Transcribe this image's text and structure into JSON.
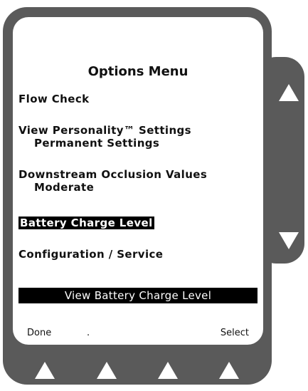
{
  "screen": {
    "title": "Options Menu",
    "menu_items": [
      {
        "label": "Flow Check",
        "sub": ""
      },
      {
        "label": "View Personality™ Settings",
        "sub": "Permanent Settings"
      },
      {
        "label": "Downstream Occlusion Values",
        "sub": "Moderate"
      },
      {
        "label": "Battery Charge Level",
        "sub": "",
        "selected": true
      },
      {
        "label": "Configuration / Service",
        "sub": ""
      }
    ],
    "status_text": "View Battery Charge Level",
    "softkeys": {
      "left": "Done",
      "middle": ".",
      "right": "Select"
    }
  },
  "hardware_buttons": {
    "side": [
      "up-arrow-icon",
      "down-arrow-icon"
    ],
    "bottom": [
      "up-arrow-icon",
      "up-arrow-icon",
      "up-arrow-icon",
      "up-arrow-icon"
    ]
  },
  "colors": {
    "device_body": "#5a5a5a",
    "screen_bg": "#ffffff",
    "highlight_bg": "#000000",
    "highlight_text": "#ffffff"
  }
}
